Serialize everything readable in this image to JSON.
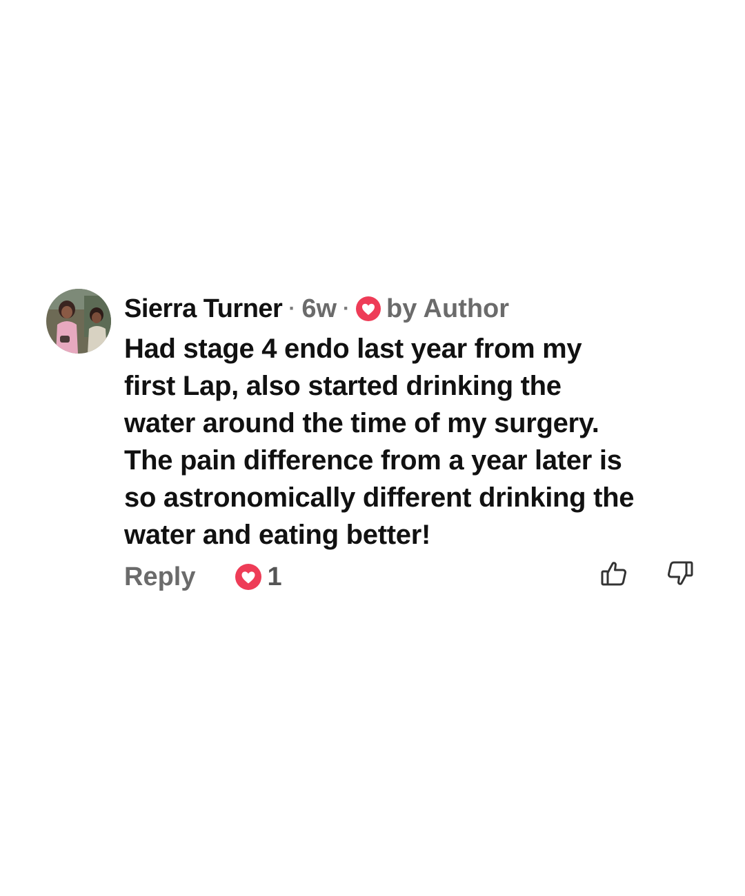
{
  "comment": {
    "author": "Sierra Turner",
    "separator": "·",
    "time_ago": "6w",
    "badge_icon": "heart-icon",
    "badge_label": "by Author",
    "text": "Had stage 4 endo last year from my\nfirst Lap, also started drinking the\nwater around the time of my surgery.\nThe pain difference from a year later is\nso astronomically different drinking the\nwater and eating better!",
    "reply_label": "Reply",
    "likes_icon": "heart-icon",
    "likes_count": "1",
    "upvote_icon": "thumbs-up-icon",
    "downvote_icon": "thumbs-down-icon"
  },
  "colors": {
    "heart": "#ee3c57",
    "muted": "#6b6b6b",
    "text": "#111111"
  }
}
